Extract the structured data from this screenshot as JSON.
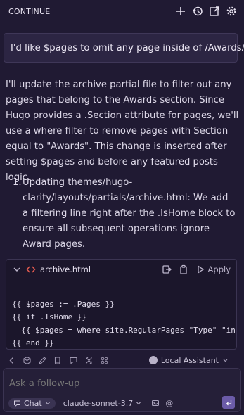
{
  "header": {
    "title": "CONTINUE",
    "icons": [
      "plus-icon",
      "history-icon",
      "open-external-icon",
      "gear-icon"
    ]
  },
  "user_message": "I'd like $pages to omit any page inside of /Awards/",
  "assistant": {
    "paragraph": "I'll update the archive partial file to filter out any pages that belong to the Awards section. Since Hugo provides a .Section attribute for pages, we'll use a where filter to remove pages with Section equal to \"Awards\". This change is inserted after setting $pages and before any featured posts logic.",
    "steps": [
      {
        "num": "1.",
        "text": "Updating themes/hugo-clarity/layouts/partials/archive.html: We add a filtering line right after the .IsHome block to ensure all subsequent operations ignore Award pages."
      }
    ]
  },
  "code_block": {
    "filename": "archive.html",
    "apply_label": "Apply",
    "lines": [
      "{{ $pages := .Pages }}",
      "{{ if .IsHome }}",
      "  {{ $pages = where site.RegularPages \"Type\" \"in\"",
      "{{ end }}"
    ]
  },
  "toolbar": {
    "assistant_label": "Local Assistant"
  },
  "input": {
    "placeholder": "Ask a follow-up",
    "mode_label": "Chat",
    "model_label": "claude-sonnet-3.7",
    "at_symbol": "@"
  },
  "colors": {
    "background": "#201a33",
    "accent": "#6b5ba8",
    "code_tag": "#e05a4f"
  }
}
